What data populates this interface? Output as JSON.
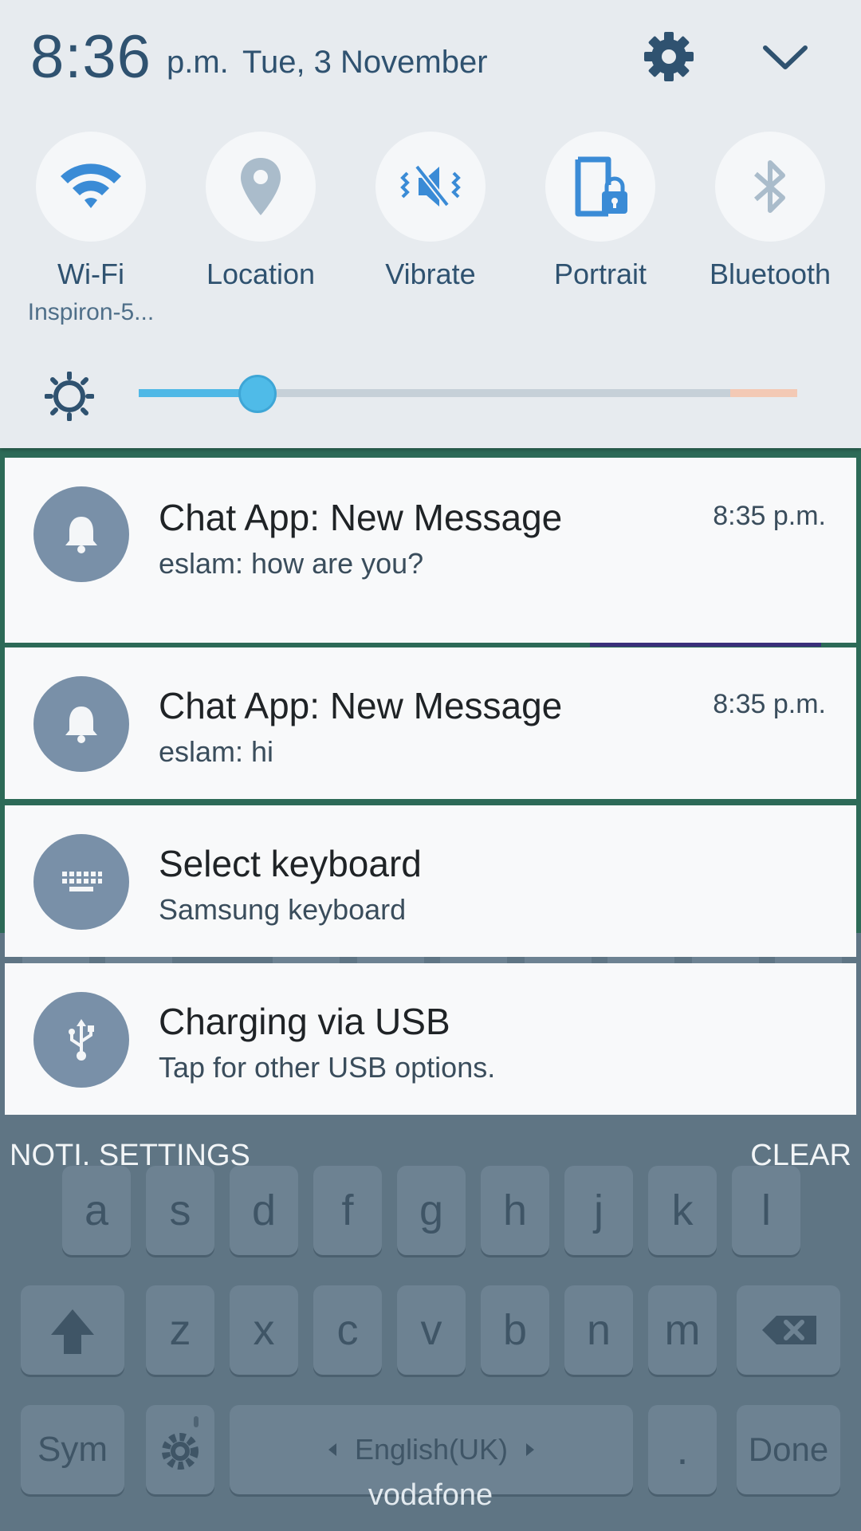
{
  "status": {
    "time": "8:36",
    "ampm": "p.m.",
    "date": "Tue, 3 November"
  },
  "icons": {
    "settings": "gear-icon",
    "collapse": "chevron-down-icon",
    "brightness": "sun-icon",
    "notification": "bell-icon",
    "keyboard": "keyboard-icon",
    "usb": "usb-icon"
  },
  "toggles": [
    {
      "label": "Wi-Fi",
      "sub": "Inspiron-5...",
      "icon": "wifi-icon",
      "active": true
    },
    {
      "label": "Location",
      "sub": "",
      "icon": "location-icon",
      "active": false
    },
    {
      "label": "Vibrate",
      "sub": "",
      "icon": "vibrate-icon",
      "active": true
    },
    {
      "label": "Portrait",
      "sub": "",
      "icon": "portrait-lock-icon",
      "active": true
    },
    {
      "label": "Bluetooth",
      "sub": "",
      "icon": "bluetooth-icon",
      "active": false
    }
  ],
  "brightness": {
    "level": 0.18
  },
  "notifications": [
    {
      "title": "Chat App: New Message",
      "body": "eslam: how are you?",
      "time": "8:35 p.m."
    },
    {
      "title": "Chat App: New Message",
      "body": "eslam: hi",
      "time": "8:35 p.m."
    },
    {
      "title": "Select keyboard",
      "body": "Samsung keyboard",
      "time": ""
    },
    {
      "title": "Charging via USB",
      "body": "Tap for other USB options.",
      "time": ""
    }
  ],
  "actions": {
    "noti_settings": "NOTI. SETTINGS",
    "clear": "CLEAR"
  },
  "keyboard": {
    "row2": [
      "a",
      "s",
      "d",
      "f",
      "g",
      "h",
      "j",
      "k",
      "l"
    ],
    "row3": [
      "z",
      "x",
      "c",
      "v",
      "b",
      "n",
      "m"
    ],
    "sym": "Sym",
    "language": "English(UK)",
    "period": ".",
    "done": "Done"
  },
  "carrier": "vodafone",
  "colors": {
    "panel": "#e7ebef",
    "accent_text": "#2f5270",
    "active_icon": "#3a8bd6",
    "inactive_icon": "#aabccb",
    "slider": "#4fb8e6",
    "avatar": "#7990a8"
  }
}
